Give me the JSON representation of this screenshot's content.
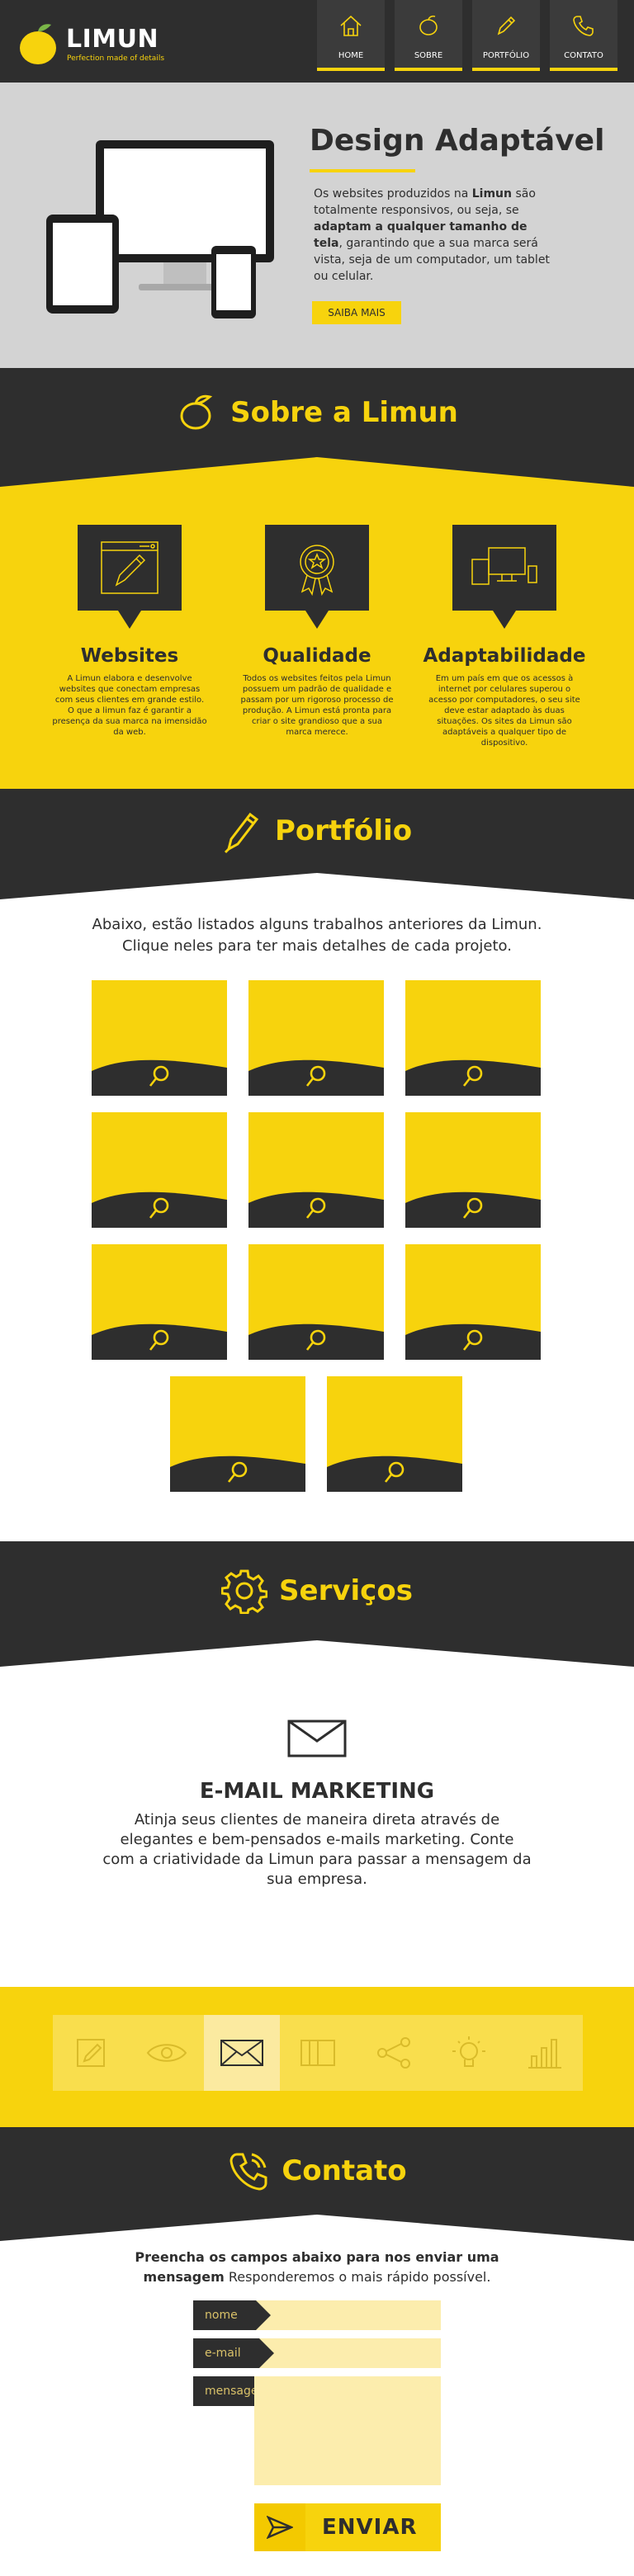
{
  "header": {
    "brand": "LIMUN",
    "tagline": "Perfection made of details",
    "nav": [
      {
        "label": "HOME",
        "icon": "home-icon"
      },
      {
        "label": "SOBRE",
        "icon": "lemon-icon"
      },
      {
        "label": "PORTFÓLIO",
        "icon": "pen-icon"
      },
      {
        "label": "CONTATO",
        "icon": "phone-icon"
      }
    ]
  },
  "hero": {
    "title": "Design Adaptável",
    "text_1": "Os websites produzidos na ",
    "text_bold_1": "Limun",
    "text_2": " são totalmente responsivos, ou seja, se ",
    "text_bold_2": "adaptam a qualquer tamanho de tela",
    "text_3": ", garantindo que a sua marca será vista, seja de um computador, um tablet ou celular.",
    "button": "SAIBA MAIS"
  },
  "sobre": {
    "title": "Sobre a Limun",
    "features": [
      {
        "title": "Websites",
        "icon": "website-icon",
        "text": "A Limun elabora e desenvolve websites que conectam empresas com seus clientes em grande estilo. O que a limun faz é garantir a presença da sua marca na imensidão da web."
      },
      {
        "title": "Qualidade",
        "icon": "medal-icon",
        "text": "Todos os websites feitos pela Limun possuem um padrão de qualidade e passam por um rigoroso processo de produção. A Limun está pronta para criar o site grandioso que a sua marca merece."
      },
      {
        "title": "Adaptabilidade",
        "icon": "devices-icon",
        "text": "Em um país em que os acessos à internet por celulares superou o acesso por computadores, o seu site deve estar adaptado às duas situações. Os sites da Limun são adaptáveis a qualquer tipo de dispositivo."
      }
    ]
  },
  "portfolio": {
    "title": "Portfólio",
    "intro_1": "Abaixo, estão listados alguns trabalhos anteriores da Limun.",
    "intro_2": "Clique neles para ter mais detalhes de cada projeto."
  },
  "servicos": {
    "title": "Serviços",
    "service_title": "E-MAIL MARKETING",
    "service_text": "Atinja seus clientes de maneira direta através de elegantes e bem-pensados e-mails marketing. Conte com a criatividade da Limun para passar a mensagem da sua empresa.",
    "tabs": [
      "pencil-icon",
      "eye-icon",
      "envelope-icon",
      "book-icon",
      "share-icon",
      "lightbulb-icon",
      "chart-icon"
    ]
  },
  "contato": {
    "title": "Contato",
    "intro_bold": "Preencha os campos abaixo para nos enviar uma mensagem",
    "intro_rest": "  Responderemos o mais rápido possível.",
    "field_name": "nome",
    "field_email": "e-mail",
    "field_message": "mensagem",
    "send": "ENVIAR"
  },
  "colors": {
    "yellow": "#f7d30d",
    "dark": "#2e2e2e",
    "hero_bg": "#d3d3d3"
  }
}
